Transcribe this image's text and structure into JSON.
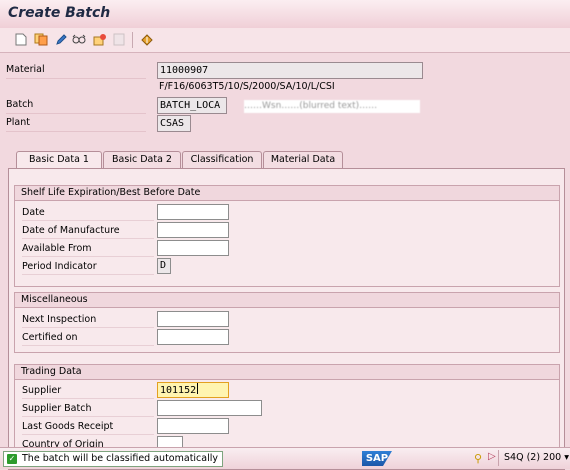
{
  "window": {
    "title": "Create Batch"
  },
  "toolbar": {
    "icons": [
      "new-document-icon",
      "copy-icon",
      "edit-pencil-icon",
      "glasses-icon",
      "classification-icon",
      "other-batch-icon",
      "back-icon"
    ]
  },
  "header": {
    "material_label": "Material",
    "material_value": "11000907",
    "material_desc": "F/F16/6063T5/10/S/2000/SA/10/L/CSI",
    "batch_label": "Batch",
    "batch_value": "BATCH_LOCA",
    "batch_desc": "……Wsn……(blurred text)……",
    "plant_label": "Plant",
    "plant_value": "CSAS"
  },
  "tabs": [
    {
      "label": "Basic Data 1",
      "active": true
    },
    {
      "label": "Basic Data 2",
      "active": false
    },
    {
      "label": "Classification",
      "active": false
    },
    {
      "label": "Material Data",
      "active": false
    }
  ],
  "shelf_life": {
    "title": "Shelf Life Expiration/Best Before Date",
    "date_label": "Date",
    "date_value": "",
    "manufacture_label": "Date of Manufacture",
    "manufacture_value": "",
    "available_label": "Available From",
    "available_value": "",
    "period_label": "Period Indicator",
    "period_value": "D"
  },
  "misc": {
    "title": "Miscellaneous",
    "next_inspection_label": "Next Inspection",
    "next_inspection_value": "",
    "certified_label": "Certified on",
    "certified_value": ""
  },
  "trading": {
    "title": "Trading Data",
    "supplier_label": "Supplier",
    "supplier_value": "101152",
    "supplier_batch_label": "Supplier Batch",
    "supplier_batch_value": "",
    "last_gr_label": "Last Goods Receipt",
    "last_gr_value": "",
    "country_label": "Country of Origin",
    "country_value": ""
  },
  "status": {
    "message": "The batch will be classified automatically",
    "logo": "SAP",
    "system": "S4Q (2) 200",
    "colors": {
      "ok": "#2d9b2d",
      "active_field": "#fff4b0"
    }
  }
}
